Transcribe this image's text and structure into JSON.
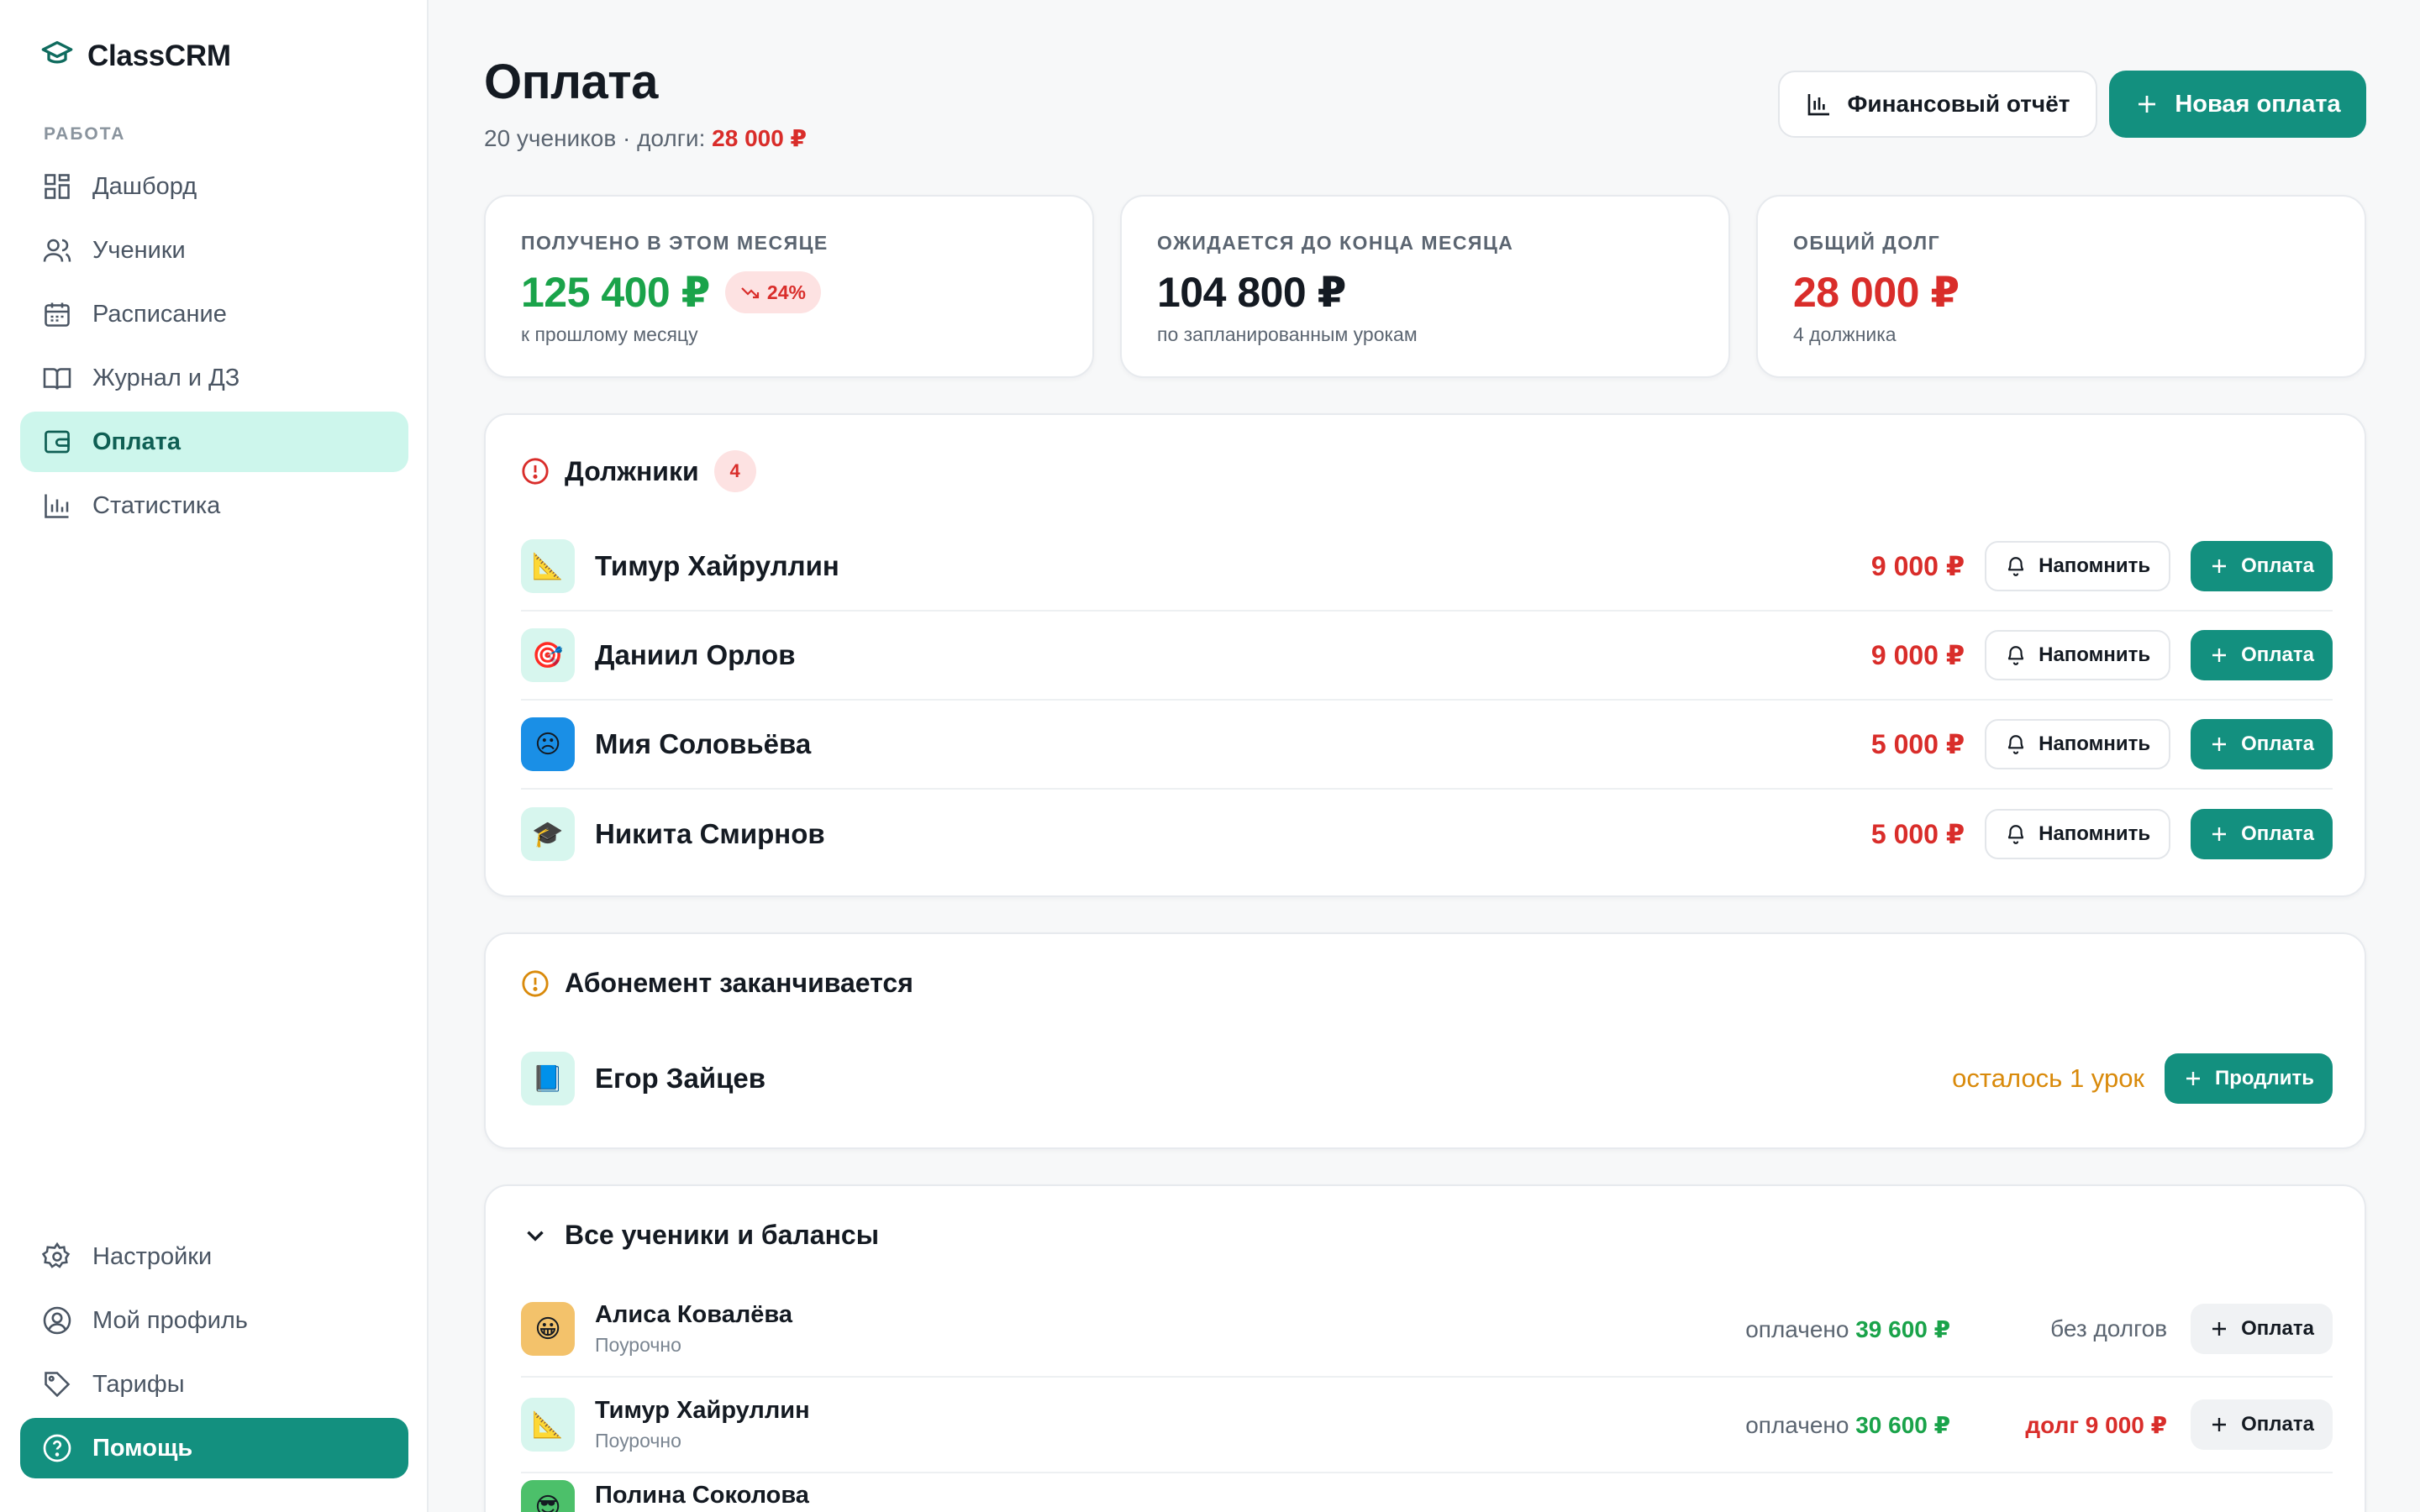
{
  "app": {
    "name": "ClassCRM"
  },
  "sidebar": {
    "section_label": "РАБОТА",
    "items": [
      {
        "label": "Дашборд",
        "icon": "dashboard-icon"
      },
      {
        "label": "Ученики",
        "icon": "users-icon"
      },
      {
        "label": "Расписание",
        "icon": "calendar-icon"
      },
      {
        "label": "Журнал и ДЗ",
        "icon": "book-icon"
      },
      {
        "label": "Оплата",
        "icon": "wallet-icon",
        "active": true
      },
      {
        "label": "Статистика",
        "icon": "chart-icon"
      }
    ],
    "bottom": [
      {
        "label": "Настройки",
        "icon": "gear-icon"
      },
      {
        "label": "Мой профиль",
        "icon": "profile-icon"
      },
      {
        "label": "Тарифы",
        "icon": "tag-icon"
      },
      {
        "label": "Помощь",
        "icon": "help-icon"
      }
    ]
  },
  "header": {
    "title": "Оплата",
    "subtitle_prefix": "20 учеников · долги:",
    "subtitle_debt": "28 000 ₽",
    "report_button": "Финансовый отчёт",
    "new_payment_button": "Новая оплата"
  },
  "stats": [
    {
      "label": "ПОЛУЧЕНО В ЭТОМ МЕСЯЦЕ",
      "value": "125 400 ₽",
      "trend": "24%",
      "note": "к прошлому месяцу"
    },
    {
      "label": "ОЖИДАЕТСЯ ДО КОНЦА МЕСЯЦА",
      "value": "104 800 ₽",
      "note": "по запланированным урокам"
    },
    {
      "label": "ОБЩИЙ ДОЛГ",
      "value": "28 000 ₽",
      "note": "4 должника"
    }
  ],
  "debtors": {
    "title": "Должники",
    "count": "4",
    "remind_label": "Напомнить",
    "pay_label": "Оплата",
    "rows": [
      {
        "name": "Тимур Хайруллин",
        "amount": "9 000 ₽",
        "avatar": "📐"
      },
      {
        "name": "Даниил Орлов",
        "amount": "9 000 ₽",
        "avatar": "🎯"
      },
      {
        "name": "Мия Соловьёва",
        "amount": "5 000 ₽",
        "avatar": "☹"
      },
      {
        "name": "Никита Смирнов",
        "amount": "5 000 ₽",
        "avatar": "🎓"
      }
    ]
  },
  "subscription": {
    "title": "Абонемент заканчивается",
    "rows": [
      {
        "name": "Егор Зайцев",
        "remaining": "осталось 1 урок",
        "action": "Продлить",
        "avatar": "📘"
      }
    ]
  },
  "balances": {
    "title": "Все ученики и балансы",
    "paid_prefix": "оплачено",
    "pay_label": "Оплата",
    "rows": [
      {
        "name": "Алиса Ковалёва",
        "plan": "Поурочно",
        "paid": "39 600 ₽",
        "balance": "без долгов",
        "avatar": "😀"
      },
      {
        "name": "Тимур Хайруллин",
        "plan": "Поурочно",
        "paid": "30 600 ₽",
        "balance": "долг 9 000 ₽",
        "avatar": "📐"
      },
      {
        "name": "Полина Соколова",
        "plan": "",
        "paid": "",
        "balance": "",
        "avatar": "😎"
      }
    ]
  },
  "colors": {
    "accent": "#13907f",
    "accent_soft": "#cdf6ec",
    "debt": "#d92d2a",
    "paid": "#1aa34a",
    "warning": "#d98a0b"
  }
}
